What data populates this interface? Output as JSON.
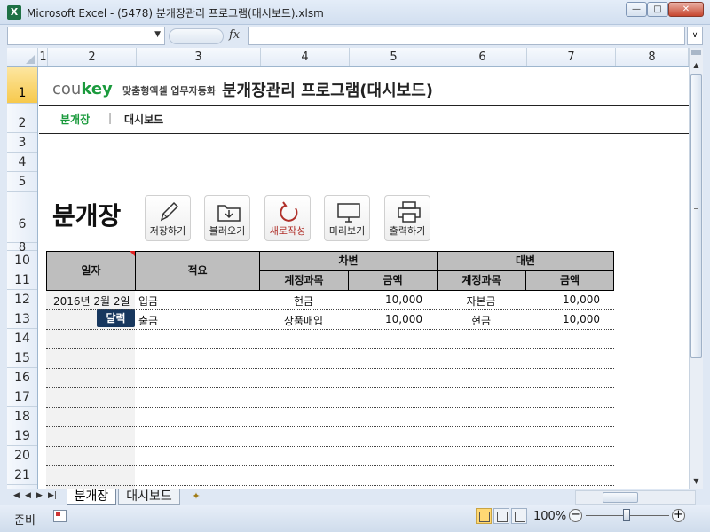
{
  "window": {
    "title": "Microsoft Excel - (5478) 분개장관리 프로그램(대시보드).xlsm",
    "app_icon": "X"
  },
  "formula_bar": {
    "fx_label": "fx",
    "namebox_value": "",
    "formula_value": ""
  },
  "columns": [
    "1",
    "2",
    "3",
    "4",
    "5",
    "6",
    "7",
    "8"
  ],
  "rows": [
    "1",
    "2",
    "3",
    "4",
    "5",
    "6",
    "8",
    "10",
    "11",
    "12",
    "13",
    "14",
    "15",
    "16",
    "17",
    "18",
    "19",
    "20",
    "21"
  ],
  "header": {
    "logo_main": "cou",
    "logo_key": "key",
    "logo_tag": "맞춤형엑셀 업무자동화",
    "title": "분개장관리 프로그램(대시보드)",
    "nav": [
      "분개장",
      "|",
      "대시보드"
    ]
  },
  "page_heading": "분개장",
  "toolbar": [
    {
      "label": "저장하기",
      "icon": "pencil-icon"
    },
    {
      "label": "불러오기",
      "icon": "folder-download-icon"
    },
    {
      "label": "새로작성",
      "icon": "refresh-icon"
    },
    {
      "label": "미리보기",
      "icon": "monitor-icon"
    },
    {
      "label": "출력하기",
      "icon": "printer-icon"
    }
  ],
  "table": {
    "headers": {
      "date": "일자",
      "summary": "적요",
      "debit": "차변",
      "credit": "대변",
      "debit_account": "계정과목",
      "debit_amount": "금액",
      "credit_account": "계정과목",
      "credit_amount": "금액"
    },
    "rows": [
      {
        "date": "2016년 2월 2일",
        "summary": "입금",
        "debit_account": "현금",
        "debit_amount": "10,000",
        "credit_account": "자본금",
        "credit_amount": "10,000"
      },
      {
        "date": "",
        "summary": "출금",
        "debit_account": "상품매입",
        "debit_amount": "10,000",
        "credit_account": "현금",
        "credit_amount": "10,000"
      }
    ],
    "date_picker_label": "달력"
  },
  "sheet_tabs": [
    "분개장",
    "대시보드"
  ],
  "status": {
    "ready": "준비",
    "zoom": "100%"
  },
  "colors": {
    "accent_green": "#1a9a3c",
    "header_gray": "#bebebe",
    "picker_navy": "#17375e",
    "refresh_red": "#b0302a"
  }
}
